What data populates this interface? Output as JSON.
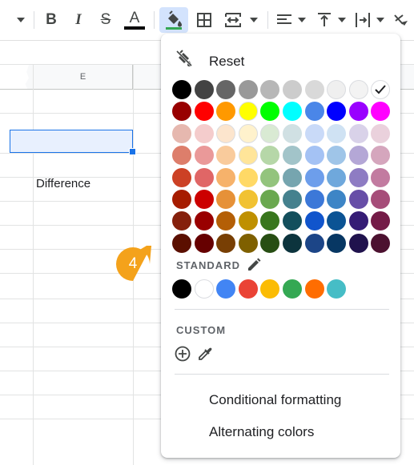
{
  "column_header": "E",
  "cell_text": "Difference",
  "step_number": "4",
  "palette": {
    "reset_label": "Reset",
    "selected_color": "#ffffff",
    "main_grid": [
      [
        "#000000",
        "#434343",
        "#666666",
        "#999999",
        "#b7b7b7",
        "#cccccc",
        "#d9d9d9",
        "#efefef",
        "#f3f3f3",
        "#ffffff"
      ],
      [
        "#980000",
        "#ff0000",
        "#ff9900",
        "#ffff00",
        "#00ff00",
        "#00ffff",
        "#4a86e8",
        "#0000ff",
        "#9900ff",
        "#ff00ff"
      ],
      [
        "#e6b8af",
        "#f4cccc",
        "#fce5cd",
        "#fff2cc",
        "#d9ead3",
        "#d0e0e3",
        "#c9daf8",
        "#cfe2f3",
        "#d9d2e9",
        "#ead1dc"
      ],
      [
        "#dd7e6b",
        "#ea9999",
        "#f9cb9c",
        "#ffe599",
        "#b6d7a8",
        "#a2c4c9",
        "#a4c2f4",
        "#9fc5e8",
        "#b4a7d6",
        "#d5a6bd"
      ],
      [
        "#cc4125",
        "#e06666",
        "#f6b26b",
        "#ffd966",
        "#93c47d",
        "#76a5af",
        "#6d9eeb",
        "#6fa8dc",
        "#8e7cc3",
        "#c27ba0"
      ],
      [
        "#a61c00",
        "#cc0000",
        "#e69138",
        "#f1c232",
        "#6aa84f",
        "#45818e",
        "#3c78d8",
        "#3d85c6",
        "#674ea7",
        "#a64d79"
      ],
      [
        "#85200c",
        "#990000",
        "#b45f06",
        "#bf9000",
        "#38761d",
        "#134f5c",
        "#1155cc",
        "#0b5394",
        "#351c75",
        "#741b47"
      ],
      [
        "#5b0f00",
        "#660000",
        "#783f04",
        "#7f6000",
        "#274e13",
        "#0c343d",
        "#1c4587",
        "#073763",
        "#20124d",
        "#4c1130"
      ]
    ],
    "standard_label": "STANDARD",
    "standard_colors": [
      "#000000",
      "#ffffff",
      "#4285f4",
      "#ea4335",
      "#fbbc04",
      "#34a853",
      "#ff6d01",
      "#46bdc6"
    ],
    "custom_label": "CUSTOM",
    "menu_items": [
      "Conditional formatting",
      "Alternating colors"
    ]
  },
  "toolbar": {
    "bold": "B",
    "italic": "I",
    "strike": "S",
    "text_color_letter": "A"
  }
}
